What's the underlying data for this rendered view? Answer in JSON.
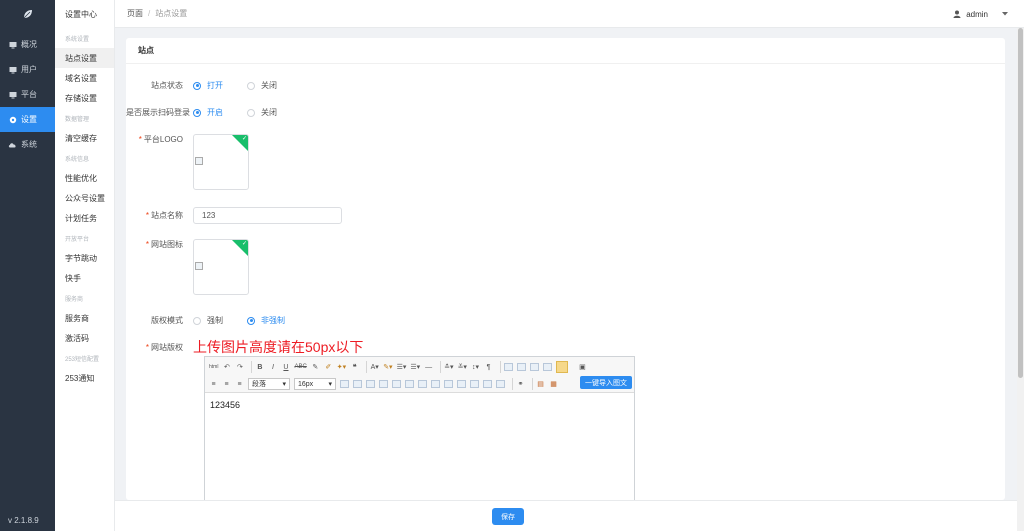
{
  "sidebar": {
    "items": [
      {
        "label": "概况",
        "icon": "monitor-icon"
      },
      {
        "label": "用户",
        "icon": "monitor-icon"
      },
      {
        "label": "平台",
        "icon": "monitor-icon"
      },
      {
        "label": "设置",
        "icon": "gear-icon"
      },
      {
        "label": "系统",
        "icon": "cloud-icon"
      }
    ],
    "active_index": 3,
    "version": "v 2.1.8.9",
    "accent": "#2d8cf0"
  },
  "submenu": {
    "title": "设置中心",
    "groups": [
      {
        "title": "系统设置",
        "items": [
          "站点设置",
          "域名设置",
          "存储设置"
        ]
      },
      {
        "title": "数据管理",
        "items": [
          "清空缓存"
        ]
      },
      {
        "title": "系统信息",
        "items": [
          "性能优化",
          "公众号设置",
          "计划任务"
        ]
      },
      {
        "title": "开放平台",
        "items": [
          "字节跳动",
          "快手"
        ]
      },
      {
        "title": "服务商",
        "items": [
          "服务商",
          "激活码"
        ]
      },
      {
        "title": "253短信配置",
        "items": [
          "253通知"
        ]
      }
    ],
    "active_item": "站点设置"
  },
  "header": {
    "breadcrumb": [
      "页面",
      "站点设置"
    ],
    "user": "admin"
  },
  "card": {
    "title": "站点",
    "fields": {
      "site_status": {
        "label": "站点状态",
        "options": [
          "打开",
          "关闭"
        ],
        "selected": "打开"
      },
      "qr_login": {
        "label": "是否展示扫码登录",
        "options": [
          "开启",
          "关闭"
        ],
        "selected": "开启"
      },
      "platform_logo": {
        "label": "平台LOGO",
        "required": true
      },
      "site_name": {
        "label": "站点名称",
        "required": true,
        "value": "123"
      },
      "site_icon": {
        "label": "网站图标",
        "required": true
      },
      "copyright_mode": {
        "label": "版权模式",
        "options": [
          "强制",
          "非强制"
        ],
        "selected": "非强制"
      },
      "site_copyright": {
        "label": "网站版权",
        "required": true,
        "note": "上传图片高度请在50px以下"
      }
    }
  },
  "editor": {
    "paragraph_select": "段落",
    "font_size_select": "16px",
    "import_button": "一键导入图文",
    "content": "123456"
  },
  "footer": {
    "save_label": "保存"
  },
  "colors": {
    "primary": "#2d8cf0",
    "sidebar_bg": "#2a3442",
    "required": "#ed4014",
    "note": "#ed1c24",
    "success": "#19be6b"
  }
}
